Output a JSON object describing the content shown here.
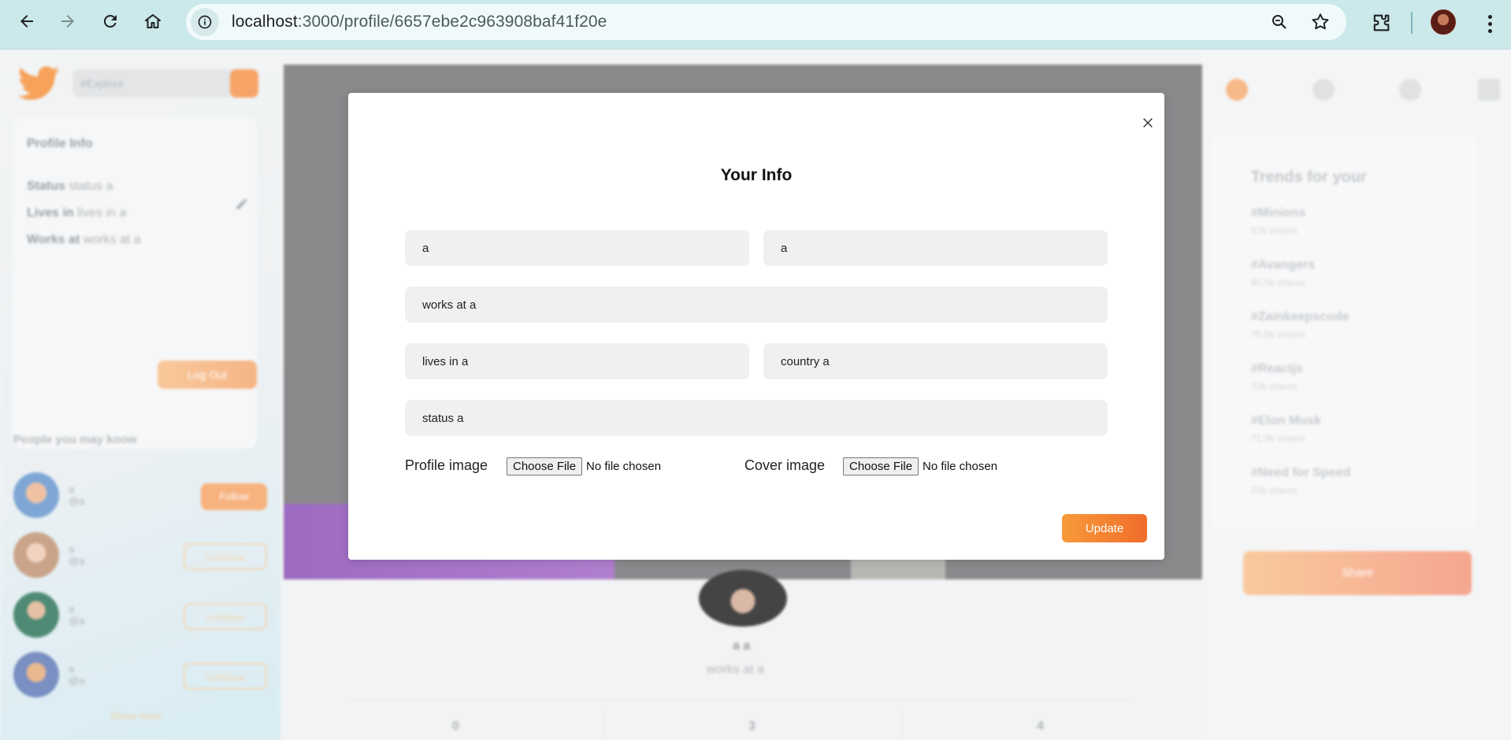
{
  "browser": {
    "url_host": "localhost",
    "url_path": ":3000/profile/6657ebe2c963908baf41f20e"
  },
  "left": {
    "search_placeholder": "#Explore",
    "profile_info_title": "Profile Info",
    "status_label": "Status",
    "status_value": "status a",
    "lives_label": "Lives in",
    "lives_value": "lives in a",
    "works_label": "Works at",
    "works_value": "works at a",
    "logout": "Log Out",
    "people_title": "People you may know",
    "people": [
      {
        "name": "a",
        "handle": "@a",
        "action": "Follow"
      },
      {
        "name": "a",
        "handle": "@a",
        "action": "Unfollow"
      },
      {
        "name": "a",
        "handle": "@a",
        "action": "Unfollow"
      },
      {
        "name": "a",
        "handle": "@a",
        "action": "Unfollow"
      }
    ],
    "show_more": "Show more"
  },
  "middle": {
    "profile_name": "a a",
    "profile_works": "works at a",
    "stats": [
      "0",
      "3",
      "4"
    ]
  },
  "right": {
    "trends_title": "Trends for your",
    "trends": [
      {
        "tag": "#Minions",
        "shares": "97k shares"
      },
      {
        "tag": "#Avangers",
        "shares": "80.5k shares"
      },
      {
        "tag": "#Zainkeepscode",
        "shares": "75.5k shares"
      },
      {
        "tag": "#Reactjs",
        "shares": "72k shares"
      },
      {
        "tag": "#Elon Musk",
        "shares": "71.9k shares"
      },
      {
        "tag": "#Need for Speed",
        "shares": "20k shares"
      }
    ],
    "share_btn": "Share"
  },
  "modal": {
    "title": "Your Info",
    "firstname": "a",
    "lastname": "a",
    "worksAt": "works at a",
    "livesIn": "lives in a",
    "country": "country a",
    "relationship": "status a",
    "profile_image_label": "Profile image",
    "cover_image_label": "Cover image",
    "choose_file": "Choose File",
    "no_file": "No file chosen",
    "update": "Update",
    "accent_color": "#f58a2f"
  }
}
